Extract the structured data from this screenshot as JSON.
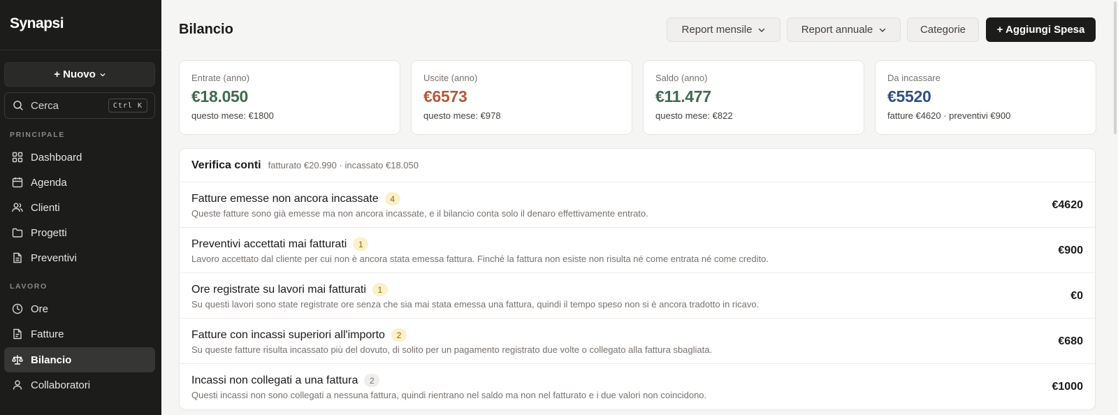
{
  "app": {
    "name": "Synapsi"
  },
  "sidebar": {
    "new_label": "+ Nuovo",
    "search": {
      "label": "Cerca",
      "shortcut": "Ctrl K"
    },
    "sections": [
      {
        "label": "PRINCIPALE"
      },
      {
        "label": "LAVORO"
      }
    ],
    "items": [
      {
        "label": "Dashboard",
        "icon": "grid-icon"
      },
      {
        "label": "Agenda",
        "icon": "calendar-icon"
      },
      {
        "label": "Clienti",
        "icon": "users-icon"
      },
      {
        "label": "Progetti",
        "icon": "folder-icon"
      },
      {
        "label": "Preventivi",
        "icon": "document-icon"
      },
      {
        "label": "Ore",
        "icon": "clock-icon"
      },
      {
        "label": "Fatture",
        "icon": "invoice-icon"
      },
      {
        "label": "Bilancio",
        "icon": "scale-icon",
        "active": true
      },
      {
        "label": "Collaboratori",
        "icon": "user-icon"
      }
    ]
  },
  "header": {
    "title": "Bilancio",
    "buttons": {
      "monthly_report": "Report mensile",
      "annual_report": "Report annuale",
      "categories": "Categorie",
      "add_expense": "+ Aggiungi Spesa"
    }
  },
  "cards": [
    {
      "label": "Entrate (anno)",
      "value": "€18.050",
      "sub": "questo mese: €1800",
      "color": "#3f6b4e"
    },
    {
      "label": "Uscite (anno)",
      "value": "€6573",
      "sub": "questo mese: €978",
      "color": "#b45a38"
    },
    {
      "label": "Saldo (anno)",
      "value": "€11.477",
      "sub": "questo mese: €822",
      "color": "#3f6b4e"
    },
    {
      "label": "Da incassare",
      "value": "€5520",
      "sub": "fatture €4620 · preventivi €900",
      "color": "#2f4f86"
    }
  ],
  "verifica": {
    "title": "Verifica conti",
    "summary": "fatturato €20.990 · incassato €18.050",
    "rows": [
      {
        "title": "Fatture emesse non ancora incassate",
        "count": "4",
        "badge": "warn",
        "desc": "Queste fatture sono già emesse ma non ancora incassate, e il bilancio conta solo il denaro effettivamente entrato.",
        "amount": "€4620"
      },
      {
        "title": "Preventivi accettati mai fatturati",
        "count": "1",
        "badge": "warn",
        "desc": "Lavoro accettato dal cliente per cui non è ancora stata emessa fattura. Finché la fattura non esiste non risulta né come entrata né come credito.",
        "amount": "€900"
      },
      {
        "title": "Ore registrate su lavori mai fatturati",
        "count": "1",
        "badge": "warn",
        "desc": "Su questi lavori sono state registrate ore senza che sia mai stata emessa una fattura, quindi il tempo speso non si è ancora tradotto in ricavo.",
        "amount": "€0"
      },
      {
        "title": "Fatture con incassi superiori all'importo",
        "count": "2",
        "badge": "warn",
        "desc": "Su queste fatture risulta incassato più del dovuto, di solito per un pagamento registrato due volte o collegato alla fattura sbagliata.",
        "amount": "€680"
      },
      {
        "title": "Incassi non collegati a una fattura",
        "count": "2",
        "badge": "neutral",
        "desc": "Questi incassi non sono collegati a nessuna fattura, quindi rientrano nel saldo ma non nel fatturato e i due valori non coincidono.",
        "amount": "€1000"
      }
    ]
  }
}
